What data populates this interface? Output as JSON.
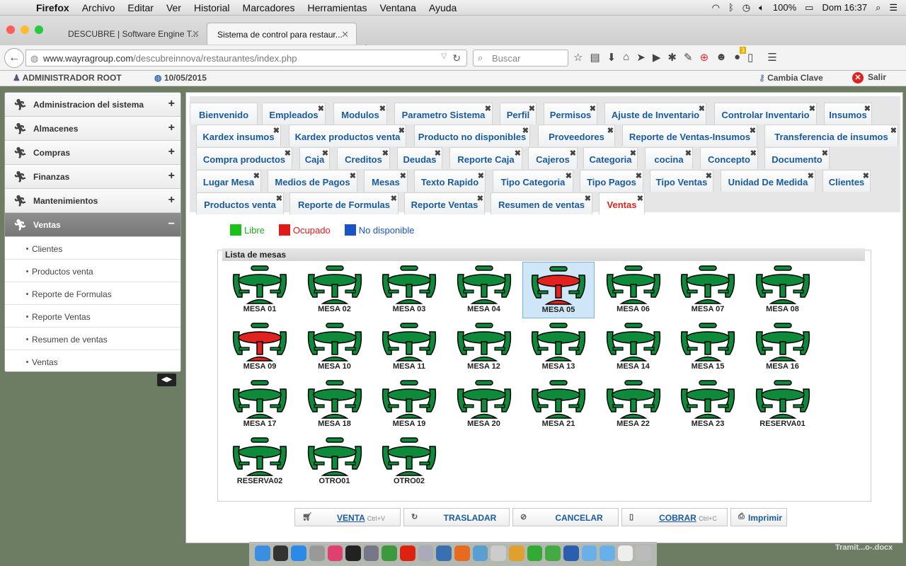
{
  "menubar": {
    "app": "Firefox",
    "items": [
      "Archivo",
      "Editar",
      "Ver",
      "Historial",
      "Marcadores",
      "Herramientas",
      "Ventana",
      "Ayuda"
    ],
    "battery": "100%",
    "clock": "Dom 16:37"
  },
  "browser": {
    "tabs": [
      {
        "title": "DESCUBRE | Software Engine T..."
      },
      {
        "title": "Sistema de control para restaur..."
      }
    ],
    "url_host": "www.wayragroup.com",
    "url_path": "/descubreinnova/restaurantes/index.php",
    "search_placeholder": "Buscar",
    "badge": "3"
  },
  "header": {
    "user": "ADMINISTRADOR ROOT",
    "date": "10/05/2015",
    "change_password": "Cambia Clave",
    "logout": "Salir"
  },
  "sidebar": {
    "sections": [
      {
        "label": "Administracion del sistema",
        "toggle": "+"
      },
      {
        "label": "Almacenes",
        "toggle": "+"
      },
      {
        "label": "Compras",
        "toggle": "+"
      },
      {
        "label": "Finanzas",
        "toggle": "+"
      },
      {
        "label": "Mantenimientos",
        "toggle": "+"
      },
      {
        "label": "Ventas",
        "toggle": "−"
      }
    ],
    "subitems": [
      "Clientes",
      "Productos venta",
      "Reporte de Formulas",
      "Reporte Ventas",
      "Resumen de ventas",
      "Ventas"
    ]
  },
  "tabs": [
    {
      "label": "Bienvenido",
      "close": false
    },
    {
      "label": "Empleados",
      "close": true
    },
    {
      "label": "Modulos",
      "close": true
    },
    {
      "label": "Parametro Sistema",
      "close": true
    },
    {
      "label": "Perfil",
      "close": true
    },
    {
      "label": "Permisos",
      "close": true
    },
    {
      "label": "Ajuste de Inventario",
      "close": true
    },
    {
      "label": "Controlar Inventario",
      "close": true
    },
    {
      "label": "Insumos",
      "close": true
    },
    {
      "label": "Kardex insumos",
      "close": true
    },
    {
      "label": "Kardex productos venta",
      "close": true
    },
    {
      "label": "Producto no disponibles",
      "close": true
    },
    {
      "label": "Proveedores",
      "close": true
    },
    {
      "label": "Reporte de Ventas-Insumos",
      "close": true
    },
    {
      "label": "Transferencia de insumos",
      "close": true
    },
    {
      "label": "Compra productos",
      "close": true
    },
    {
      "label": "Caja",
      "close": true
    },
    {
      "label": "Creditos",
      "close": true
    },
    {
      "label": "Deudas",
      "close": true
    },
    {
      "label": "Reporte Caja",
      "close": true
    },
    {
      "label": "Cajeros",
      "close": true
    },
    {
      "label": "Categoria",
      "close": true
    },
    {
      "label": "cocina",
      "close": true
    },
    {
      "label": "Concepto",
      "close": true
    },
    {
      "label": "Documento",
      "close": true
    },
    {
      "label": "Lugar Mesa",
      "close": true
    },
    {
      "label": "Medios de Pagos",
      "close": true
    },
    {
      "label": "Mesas",
      "close": true
    },
    {
      "label": "Texto Rapido",
      "close": true
    },
    {
      "label": "Tipo Categoria",
      "close": true
    },
    {
      "label": "Tipo Pagos",
      "close": true
    },
    {
      "label": "Tipo Ventas",
      "close": true
    },
    {
      "label": "Unidad De Medida",
      "close": true
    },
    {
      "label": "Clientes",
      "close": true
    },
    {
      "label": "Productos venta",
      "close": true
    },
    {
      "label": "Reporte de Formulas",
      "close": true
    },
    {
      "label": "Reporte Ventas",
      "close": true
    },
    {
      "label": "Resumen de ventas",
      "close": true
    },
    {
      "label": "Ventas",
      "close": true,
      "active": true
    }
  ],
  "legend": [
    {
      "label": "Libre",
      "color": "#19c219"
    },
    {
      "label": "Ocupado",
      "color": "#e01919"
    },
    {
      "label": "No disponible",
      "color": "#1a52c8"
    }
  ],
  "panel_title": "Lista de mesas",
  "mesas": [
    {
      "name": "MESA 01",
      "status": "libre"
    },
    {
      "name": "MESA 02",
      "status": "libre"
    },
    {
      "name": "MESA 03",
      "status": "libre"
    },
    {
      "name": "MESA 04",
      "status": "libre"
    },
    {
      "name": "MESA 05",
      "status": "ocupado",
      "selected": true
    },
    {
      "name": "MESA 06",
      "status": "libre"
    },
    {
      "name": "MESA 07",
      "status": "libre"
    },
    {
      "name": "MESA 08",
      "status": "libre"
    },
    {
      "name": "MESA 09",
      "status": "ocupado"
    },
    {
      "name": "MESA 10",
      "status": "libre"
    },
    {
      "name": "MESA 11",
      "status": "libre"
    },
    {
      "name": "MESA 12",
      "status": "libre"
    },
    {
      "name": "MESA 13",
      "status": "libre"
    },
    {
      "name": "MESA 14",
      "status": "libre"
    },
    {
      "name": "MESA 15",
      "status": "libre"
    },
    {
      "name": "MESA 16",
      "status": "libre"
    },
    {
      "name": "MESA 17",
      "status": "libre"
    },
    {
      "name": "MESA 18",
      "status": "libre"
    },
    {
      "name": "MESA 19",
      "status": "libre"
    },
    {
      "name": "MESA 20",
      "status": "libre"
    },
    {
      "name": "MESA 21",
      "status": "libre"
    },
    {
      "name": "MESA 22",
      "status": "libre"
    },
    {
      "name": "MESA 23",
      "status": "libre"
    },
    {
      "name": "RESERVA01",
      "status": "libre"
    },
    {
      "name": "RESERVA02",
      "status": "libre"
    },
    {
      "name": "OTRO01",
      "status": "libre"
    },
    {
      "name": "OTRO02",
      "status": "libre"
    }
  ],
  "colors": {
    "libre": "#0d8a3a",
    "ocupado": "#e0231e",
    "chair_libre": "#0d8a3a",
    "chair_ocupado": "#0d8a3a"
  },
  "actions": [
    {
      "icon": "cart-icon",
      "label": "VENTA",
      "shortcut": "Ctrl+V"
    },
    {
      "icon": "refresh-icon",
      "label": "TRASLADAR",
      "shortcut": ""
    },
    {
      "icon": "cancel-icon",
      "label": "CANCELAR",
      "shortcut": ""
    },
    {
      "icon": "clipboard-icon",
      "label": "COBRAR",
      "shortcut": "Ctrl+C"
    },
    {
      "icon": "print-icon",
      "label": "Imprimir",
      "shortcut": ""
    }
  ],
  "dock_file": "Tramit...o-.docx"
}
